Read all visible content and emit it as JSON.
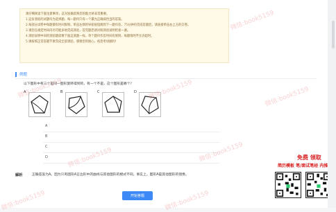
{
  "notice": {
    "lines": [
      "请仔细阅读下面注意事项，这对准确反映您的能力将非常重要。",
      "1.这份测验的试题均为选择题，每一题目只有一个最为正确或恰当的答案。",
      "2.每部分试卷中每题都有时间限制，单击左侧的导航按钮跳到下一题作答，75分钟内完成答题后，请直接单击右上方的交卷。",
      "3.请您在规定时间内尽可能多地完成测验，答完题后请对照测验说明检查一遍。",
      "4.测验说明中间的测验题就像下面这道题一样，单个题目作答时间有限制，每题限时不允许超时。",
      "5.请按照正常答题节奏完成全部测验，感谢您的耐心，祝您考试顺利！"
    ]
  },
  "question": {
    "section_label": "例题",
    "stem": "以下图形中有三个是同一图形旋转得到的，有一个不是，这个图形是哪个？",
    "figure_letters": [
      "A",
      "B",
      "C",
      "D"
    ],
    "options": [
      "A",
      "B",
      "C",
      "D"
    ]
  },
  "analysis": {
    "label": "解析",
    "text": "正确答案为A。因为只有图形A正边形中的曲线与其他图形的模式不同。事实上，图形A是其他图形的镜像。"
  },
  "submit_label": "开始答题",
  "promo": {
    "line1": "免费 领取",
    "line2": "简历模板 笔/面试笔经 内推"
  },
  "watermark": "微信:book5159",
  "colors": {
    "accent": "#3d8af7",
    "watermark": "#eb7878",
    "promo": "#d81e1e"
  }
}
